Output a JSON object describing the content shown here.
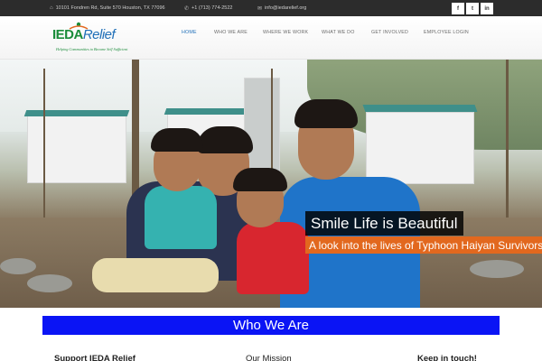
{
  "topbar": {
    "address": "10101 Fondren Rd, Suite 570 Houston, TX 77096",
    "phone": "+1 (713) 774-2522",
    "email": "info@iedarelief.org",
    "social": [
      "f",
      "t",
      "in"
    ]
  },
  "logo": {
    "name_a": "IEDA",
    "name_b": "Relief",
    "tagline": "Helping Communities to Become Self Sufficient"
  },
  "nav": {
    "items": [
      "HOME",
      "WHO WE ARE",
      "WHERE WE WORK",
      "WHAT WE DO",
      "GET INVOLVED",
      "EMPLOYEE LOGIN"
    ],
    "active_index": 0
  },
  "hero": {
    "caption_title": "Smile Life is Beautiful",
    "caption_subtitle": "A look into the lives of Typhoon Haiyan Survivors"
  },
  "section": {
    "title": "Who We Are"
  },
  "columns": {
    "left": "Support IEDA Relief",
    "middle": "Our Mission",
    "right": "Keep in touch!"
  },
  "colors": {
    "accent": "#1f6fb8",
    "brand_green": "#1a8c3a",
    "caption_orange": "#e2681e",
    "section_blue": "#0a14f5"
  }
}
